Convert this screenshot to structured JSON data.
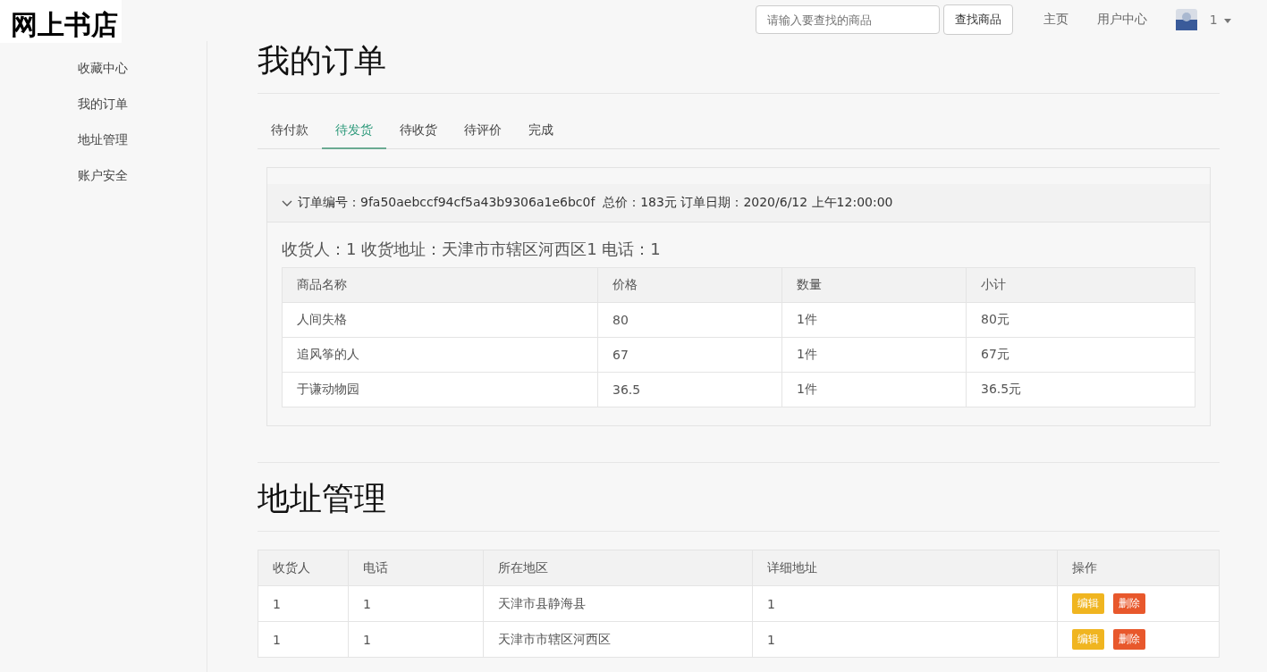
{
  "logo": "网上书店",
  "search": {
    "placeholder": "请输入要查找的商品",
    "button": "查找商品"
  },
  "nav": [
    "主页",
    "用户中心"
  ],
  "user": {
    "name": "1"
  },
  "sidebar": {
    "items": [
      {
        "label": "收藏中心",
        "selected": false
      },
      {
        "label": "我的订单",
        "selected": false
      },
      {
        "label": "地址管理",
        "selected": false
      },
      {
        "label": "账户安全",
        "selected": false
      }
    ]
  },
  "orders_title": "我的订单",
  "tabs": [
    {
      "label": "待付款",
      "selected": false
    },
    {
      "label": "待发货",
      "selected": true
    },
    {
      "label": "待收货",
      "selected": false
    },
    {
      "label": "待评价",
      "selected": false
    },
    {
      "label": "完成",
      "selected": false
    }
  ],
  "order": {
    "expanded": true,
    "header": "订单编号：9fa50aebccf94cf5a43b9306a1e6bc0f  总价：183元 订单日期：2020/6/12 上午12:00:00",
    "recipient": "收货人：1  收货地址：天津市市辖区河西区1 电话：1",
    "columns": [
      "商品名称",
      "价格",
      "数量",
      "小计"
    ],
    "rows": [
      [
        "人间失格",
        "80",
        "1件",
        "80元"
      ],
      [
        "追风筝的人",
        "67",
        "1件",
        "67元"
      ],
      [
        "于谦动物园",
        "36.5",
        "1件",
        "36.5元"
      ]
    ]
  },
  "address_title": "地址管理",
  "addresses": {
    "columns": [
      "收货人",
      "电话",
      "所在地区",
      "详细地址",
      "操作"
    ],
    "rows": [
      {
        "cells": [
          "1",
          "1",
          "天津市县静海县",
          "1"
        ],
        "actions": [
          "编辑",
          "删除"
        ]
      },
      {
        "cells": [
          "1",
          "1",
          "天津市市辖区河西区",
          "1"
        ],
        "actions": [
          "编辑",
          "删除"
        ]
      }
    ]
  }
}
